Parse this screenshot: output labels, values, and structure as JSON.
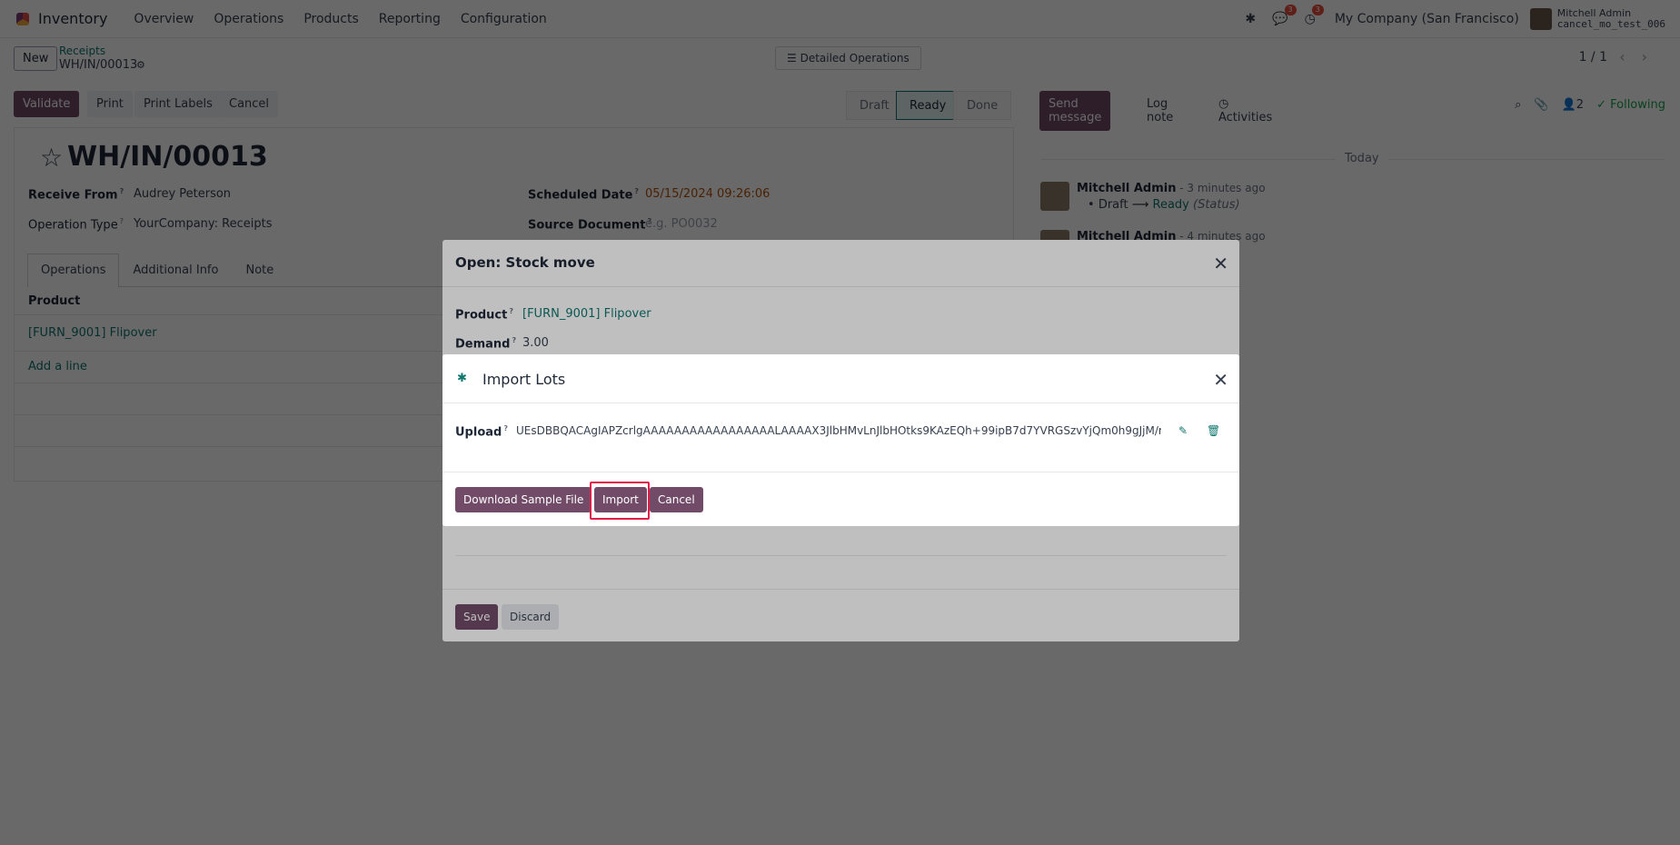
{
  "navbar": {
    "app_name": "Inventory",
    "menu": [
      "Overview",
      "Operations",
      "Products",
      "Reporting",
      "Configuration"
    ],
    "messages_badge": "3",
    "activities_badge": "3",
    "company": "My Company (San Francisco)",
    "user_name": "Mitchell Admin",
    "user_db": "cancel_mo_test_006"
  },
  "control": {
    "new_label": "New",
    "breadcrumb_parent": "Receipts",
    "breadcrumb_current": "WH/IN/00013",
    "detailed_operations": "Detailed Operations",
    "pager": "1 / 1"
  },
  "statusbar": {
    "validate": "Validate",
    "print": "Print",
    "print_labels": "Print Labels",
    "cancel": "Cancel",
    "stages": [
      "Draft",
      "Ready",
      "Done"
    ],
    "active_stage": "Ready"
  },
  "chatter": {
    "send_message": "Send message",
    "log_note": "Log note",
    "activities": "Activities",
    "followers_count": "2",
    "following": "Following",
    "today": "Today",
    "messages": [
      {
        "author": "Mitchell Admin",
        "time": " - 3 minutes ago",
        "from": "Draft",
        "to": "Ready",
        "field": "(Status)"
      },
      {
        "author": "Mitchell Admin",
        "time": " - 4 minutes ago"
      }
    ]
  },
  "form": {
    "title": "WH/IN/00013",
    "receive_from_label": "Receive From",
    "receive_from": "Audrey Peterson",
    "operation_type_label": "Operation Type",
    "operation_type": "YourCompany: Receipts",
    "scheduled_date_label": "Scheduled Date",
    "scheduled_date": "05/15/2024 09:26:06",
    "source_document_label": "Source Document",
    "source_document_placeholder": "e.g. PO0032",
    "tabs": [
      "Operations",
      "Additional Info",
      "Note"
    ],
    "product_col": "Product",
    "product_line": "[FURN_9001] Flipover",
    "add_line": "Add a line"
  },
  "stock_move_dialog": {
    "title": "Open: Stock move",
    "product_label": "Product",
    "product": "[FURN_9001] Flipover",
    "demand_label": "Demand",
    "demand": "3.00",
    "save": "Save",
    "discard": "Discard"
  },
  "import_dialog": {
    "title": "Import Lots",
    "upload_label": "Upload",
    "upload_value": "UEsDBBQACAgIAPZcrlgAAAAAAAAAAAAAAAAALAAAAX3JlbHMvLnJlbHOtks9KAzEQh+99ipB7d7YVRGSzvYjQm0h9gJjM/mE3r",
    "download_sample": "Download Sample File",
    "import": "Import",
    "cancel": "Cancel"
  }
}
